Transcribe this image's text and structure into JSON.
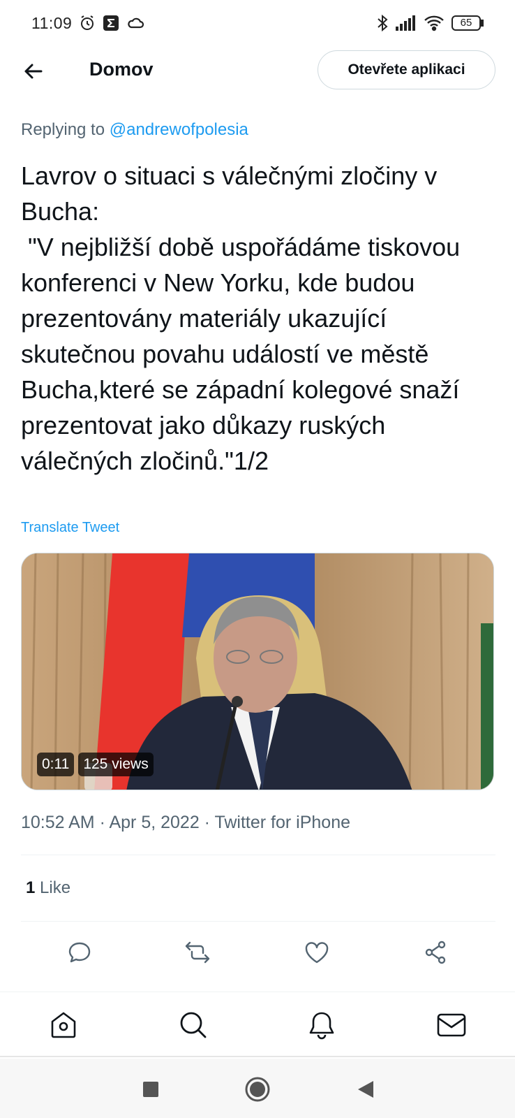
{
  "status_bar": {
    "time": "11:09",
    "battery": "65",
    "icons": [
      "alarm-icon",
      "sigma-icon",
      "cloud-icon",
      "bluetooth-icon",
      "signal-icon",
      "wifi-icon",
      "battery-icon"
    ]
  },
  "header": {
    "title": "Domov",
    "open_app_label": "Otevřete aplikaci"
  },
  "tweet": {
    "replying_prefix": "Replying to ",
    "replying_handle": "@andrewofpolesia",
    "text": "Lavrov o situaci s válečnými zločiny v Bucha:\n \"V nejbližší době uspořádáme tiskovou konferenci v New Yorku, kde budou prezentovány materiály ukazující skutečnou povahu událostí ve městě Bucha,které se západní kolegové snaží prezentovat jako důkazy ruských válečných zločinů.\"1/2",
    "translate_label": "Translate Tweet",
    "video": {
      "duration": "0:11",
      "views": "125 views"
    },
    "timestamp": "10:52 AM · Apr 5, 2022 · Twitter for iPhone",
    "likes_count": "1",
    "likes_label": " Like"
  },
  "actions": [
    "reply-icon",
    "retweet-icon",
    "like-icon",
    "share-icon"
  ],
  "bottom_nav": [
    "home-icon",
    "search-icon",
    "notifications-icon",
    "messages-icon"
  ],
  "colors": {
    "accent": "#1d9bf0",
    "secondary_text": "#536471",
    "primary_text": "#0f1419"
  }
}
